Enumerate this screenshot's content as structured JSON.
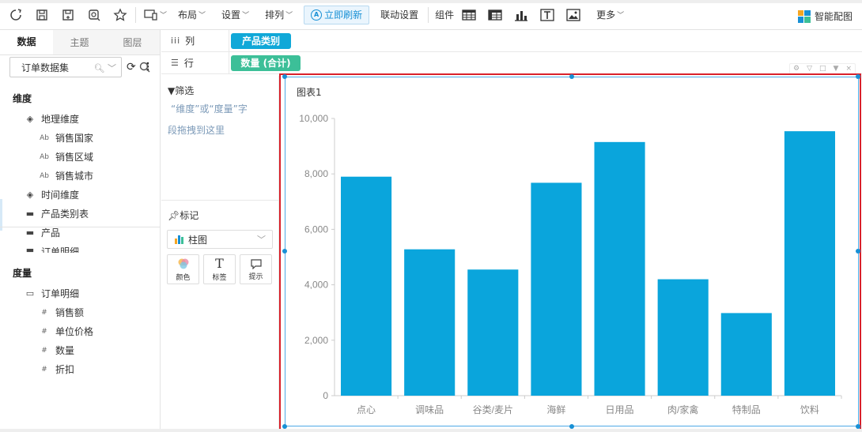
{
  "toolbar": {
    "icons": [
      "refresh-icon",
      "save-icon",
      "save-as-icon",
      "preview-icon",
      "star-icon"
    ],
    "device_icon": "device-icon",
    "menus": [
      {
        "label": "布局"
      },
      {
        "label": "设置"
      },
      {
        "label": "排列"
      }
    ],
    "refresh_label": "立即刷新",
    "linkage_label": "联动设置",
    "components_label": "组件",
    "component_icons": [
      "table-icon",
      "crosstable-icon",
      "bar-chart-icon",
      "text-icon",
      "image-icon"
    ],
    "more_label": "更多",
    "smart_chart_label": "智能配图",
    "accent": "#1890d5"
  },
  "left": {
    "tabs": [
      {
        "label": "数据",
        "active": true
      },
      {
        "label": "主题",
        "active": false
      },
      {
        "label": "图层",
        "active": false
      }
    ],
    "dataset_label": "订单数据集",
    "dimension_header": "维度",
    "dimensions": [
      {
        "label": "地理维度",
        "icon": "layers-icon",
        "level": 0
      },
      {
        "label": "销售国家",
        "icon": "text-field-icon",
        "level": 1
      },
      {
        "label": "销售区域",
        "icon": "text-field-icon",
        "level": 1
      },
      {
        "label": "销售城市",
        "icon": "text-field-icon",
        "level": 1
      },
      {
        "label": "时间维度",
        "icon": "layers-icon",
        "level": 0
      },
      {
        "label": "产品类别表",
        "icon": "folder-icon",
        "level": 0
      },
      {
        "label": "产品",
        "icon": "folder-icon",
        "level": 0
      },
      {
        "label": "订单明细",
        "icon": "folder-icon",
        "level": 0
      }
    ],
    "measure_header": "度量",
    "measures": [
      {
        "label": "订单明细",
        "icon": "folder-open-icon",
        "level": 0
      },
      {
        "label": "销售额",
        "icon": "number-field-icon",
        "level": 1
      },
      {
        "label": "单位价格",
        "icon": "number-field-icon",
        "level": 1
      },
      {
        "label": "数量",
        "icon": "number-field-icon",
        "level": 1
      },
      {
        "label": "折扣",
        "icon": "number-field-icon",
        "level": 1
      }
    ]
  },
  "shelves": {
    "columns_label": "列",
    "columns_pill": "产品类别",
    "rows_label": "行",
    "rows_pill": "数量 (合计)"
  },
  "filter": {
    "title": "筛选",
    "hint_line1": "“维度”或“度量”字",
    "hint_line2": "段拖拽到这里"
  },
  "marks": {
    "title": "标记",
    "chart_type": "柱图",
    "buttons": [
      {
        "label": "颜色",
        "icon": "color-icon"
      },
      {
        "label": "标签",
        "icon": "text-icon"
      },
      {
        "label": "提示",
        "icon": "tooltip-icon"
      }
    ]
  },
  "chart_data": {
    "type": "bar",
    "title": "图表1",
    "categories": [
      "点心",
      "调味品",
      "谷类/麦片",
      "海鲜",
      "日用品",
      "肉/家禽",
      "特制品",
      "饮料"
    ],
    "values": [
      7900,
      5280,
      4550,
      7680,
      9150,
      4200,
      2980,
      9540
    ],
    "y_tick_labels": [
      "0",
      "2,000",
      "4,000",
      "6,000",
      "8,000",
      "10,000"
    ],
    "ylim": [
      0,
      10000
    ],
    "y_ticks": [
      0,
      2000,
      4000,
      6000,
      8000,
      10000
    ],
    "bar_color": "#0aa5dc",
    "grid": false,
    "legend": "none"
  }
}
